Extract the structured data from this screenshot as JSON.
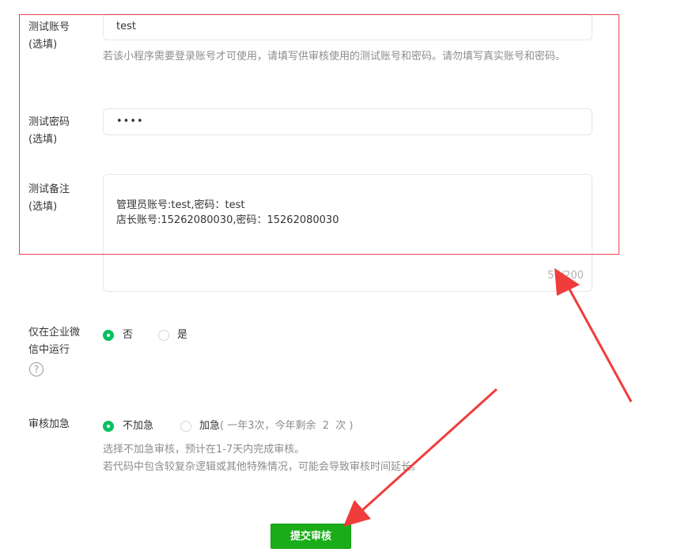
{
  "test_account": {
    "label": "测试账号\n(选填)",
    "value": "test",
    "hint": "若该小程序需要登录账号才可使用，请填写供审核使用的测试账号和密码。请勿填写真实账号和密码。"
  },
  "test_password": {
    "label": "测试密码\n(选填)",
    "value": "••••"
  },
  "test_note": {
    "label": "测试备注\n(选填)",
    "value": "管理员账号:test,密码：test\n店长账号:15262080030,密码：15262080030",
    "counter": "56/200"
  },
  "wecom_only": {
    "label": "仅在企业微信中运行",
    "option_no": "否",
    "option_yes": "是",
    "selected": "否"
  },
  "review_urgency": {
    "label": "审核加急",
    "option_normal": "不加急",
    "option_urgent": "加急",
    "urgent_detail": "( 一年3次，今年剩余  2  次 )",
    "hint_line1": "选择不加急审核，预计在1-7天内完成审核。",
    "hint_line2": "若代码中包含较复杂逻辑或其他特殊情况，可能会导致审核时间延长。",
    "selected": "不加急"
  },
  "submit_label": "提交审核",
  "annotation_color": "#e8454f",
  "accent_color": "#07c160",
  "submit_color": "#1aad19"
}
